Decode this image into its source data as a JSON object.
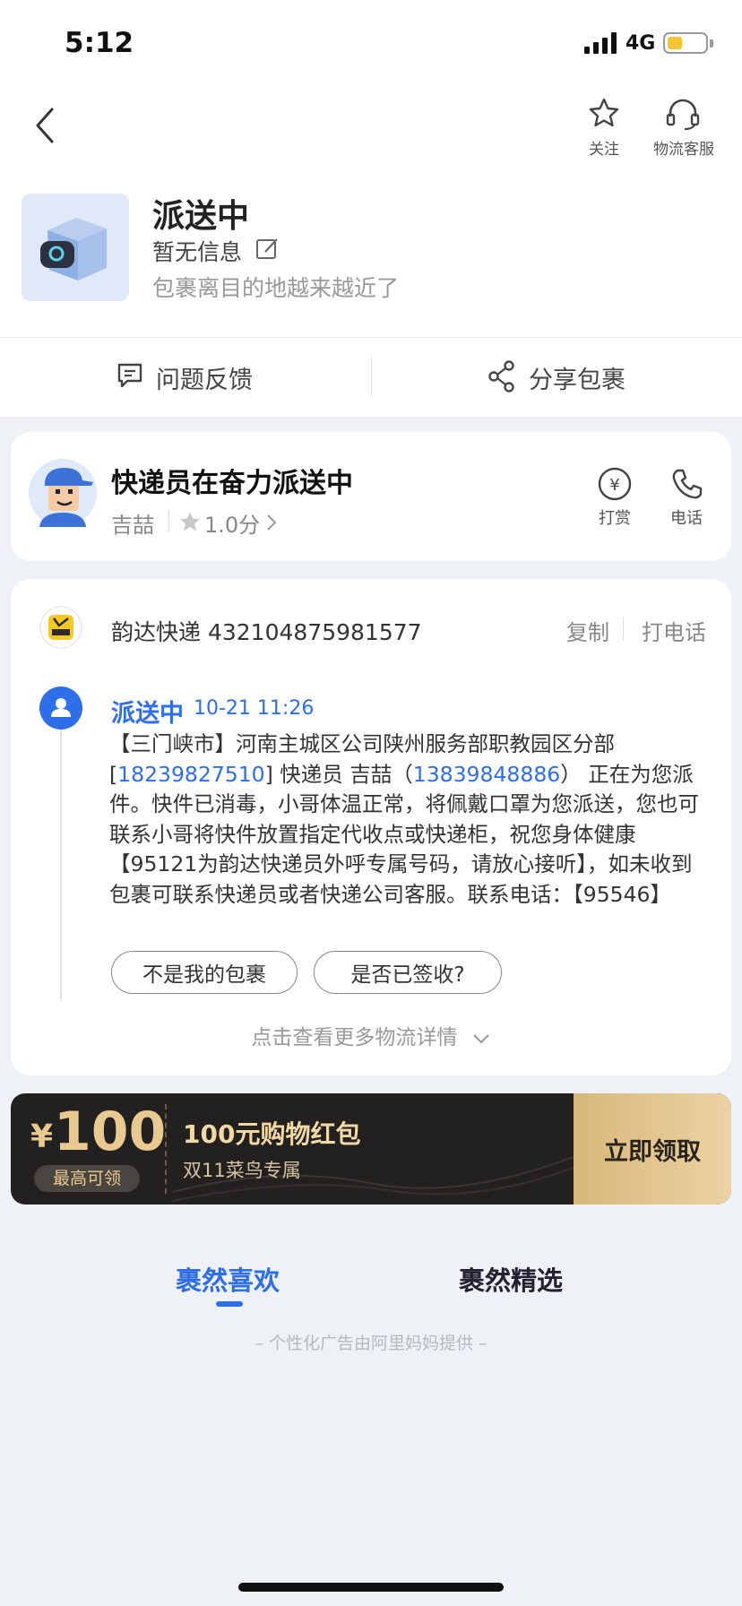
{
  "status_bar": {
    "time": "5:12",
    "network": "4G"
  },
  "nav": {
    "follow_label": "关注",
    "service_label": "物流客服"
  },
  "package": {
    "status": "派送中",
    "info": "暂无信息",
    "subtitle": "包裹离目的地越来越近了"
  },
  "actions": {
    "feedback": "问题反馈",
    "share": "分享包裹"
  },
  "courier": {
    "title": "快递员在奋力派送中",
    "name": "吉喆",
    "rating": "1.0分",
    "tip_label": "打赏",
    "phone_label": "电话"
  },
  "tracking": {
    "company": "韵达快递",
    "number": "432104875981577",
    "copy_label": "复制",
    "call_label": "打电话",
    "event_status": "派送中",
    "event_time": "10-21 11:26",
    "body_1": "【三门峡市】河南主城区公司陕州服务部职教园区分部",
    "body_bracket_open": "[",
    "body_phone_1": "18239827510",
    "body_2": "] 快递员 吉喆（",
    "body_phone_2": "13839848886",
    "body_3": "） 正在为您派件。快件已消毒，小哥体温正常，将佩戴口罩为您派送，您也可联系小哥将快件放置指定代收点或快递柜，祝您身体健康【95121为韵达快递员外呼专属号码，请放心接听】，如未收到包裹可联系快递员或者快递公司客服。联系电话：【95546】",
    "not_mine": "不是我的包裹",
    "signed": "是否已签收?",
    "more": "点击查看更多物流详情"
  },
  "promo": {
    "yen": "¥",
    "amount": "100",
    "badge": "最高可领",
    "title": "100元购物红包",
    "subtitle": "双11菜鸟专属",
    "button": "立即领取"
  },
  "tabs": {
    "tab1": "裹然喜欢",
    "tab2": "裹然精选"
  },
  "ad_note": "– 个性化广告由阿里妈妈提供 –",
  "colors": {
    "accent": "#2e6ee8",
    "promo_gold": "#e8c98f"
  },
  "icons": [
    "back-icon",
    "star-icon",
    "headset-icon",
    "edit-icon",
    "chat-icon",
    "share-icon",
    "yen-icon",
    "phone-icon",
    "user-icon",
    "chevron-down-icon"
  ]
}
